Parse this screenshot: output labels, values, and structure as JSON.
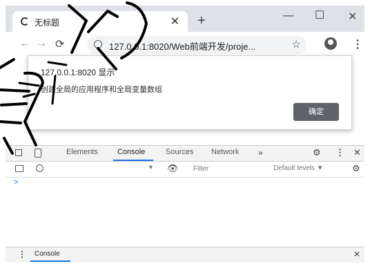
{
  "browser": {
    "tab_title": "无标题",
    "tab_close_icon": "close-icon",
    "new_tab_icon": "plus-icon",
    "window_controls": [
      "minimize-icon",
      "maximize-icon",
      "close-icon"
    ],
    "url": "127.0.0.1:8020/Web前端开发/proje...",
    "nav_icons": [
      "back-arrow-icon",
      "forward-arrow-icon",
      "reload-icon",
      "info-icon",
      "star-icon",
      "profile-icon",
      "menu-icon"
    ]
  },
  "dialog": {
    "title": "127.0.0.1:8020 显示",
    "message": "创建全局的应用程序和全局变量数组",
    "ok_label": "确定"
  },
  "devtools": {
    "tabs": [
      {
        "label": "Elements"
      },
      {
        "label": "Console",
        "active": true
      },
      {
        "label": "Sources"
      },
      {
        "label": "Network"
      }
    ],
    "more_tabs": "»",
    "filter_placeholder": "Filter",
    "levels_label": "Default levels ▼",
    "prompt": ">",
    "drawer": {
      "tab_label": "Console"
    }
  },
  "overlay": {
    "description_icon": "handwriting-icon",
    "accent_color": "#000000"
  }
}
